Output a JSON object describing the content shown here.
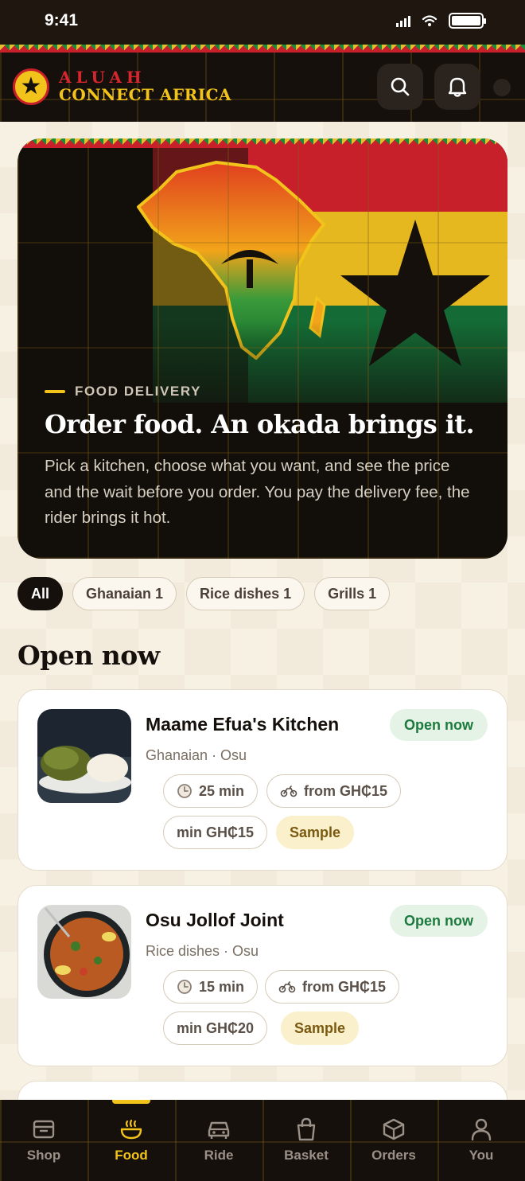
{
  "status_bar": {
    "time": "9:41"
  },
  "header": {
    "brand_line1": "ALUAH",
    "brand_line2": "CONNECT AFRICA",
    "search_icon": "search-icon",
    "bell_icon": "bell-icon"
  },
  "hero": {
    "eyebrow": "FOOD DELIVERY",
    "title": "Order food. An okada brings it.",
    "body": "Pick a kitchen, choose what you want, and see the price and the wait before you order. You pay the delivery fee, the rider brings it hot."
  },
  "filters": [
    {
      "label": "All",
      "active": true
    },
    {
      "label": "Ghanaian 1",
      "active": false
    },
    {
      "label": "Rice dishes 1",
      "active": false
    },
    {
      "label": "Grills 1",
      "active": false
    }
  ],
  "section_title": "Open now",
  "kitchens": [
    {
      "name": "Maame Efua's Kitchen",
      "meta": "Ghanaian · Osu",
      "status": "Open now",
      "time": "25 min",
      "delivery": "from GH₵15",
      "minimum": "min GH₵15",
      "tag": "Sample"
    },
    {
      "name": "Osu Jollof Joint",
      "meta": "Rice dishes · Osu",
      "status": "Open now",
      "time": "15 min",
      "delivery": "from GH₵15",
      "minimum": "min GH₵20",
      "tag": "Sample"
    }
  ],
  "nav": {
    "shop": "Shop",
    "food": "Food",
    "ride": "Ride",
    "basket": "Basket",
    "orders": "Orders",
    "you": "You"
  },
  "colors": {
    "brand_red": "#d8262f",
    "brand_gold": "#f2c31a",
    "brand_green": "#1d8a3a",
    "dark": "#15100b",
    "open_green": "#1d7a3e"
  }
}
